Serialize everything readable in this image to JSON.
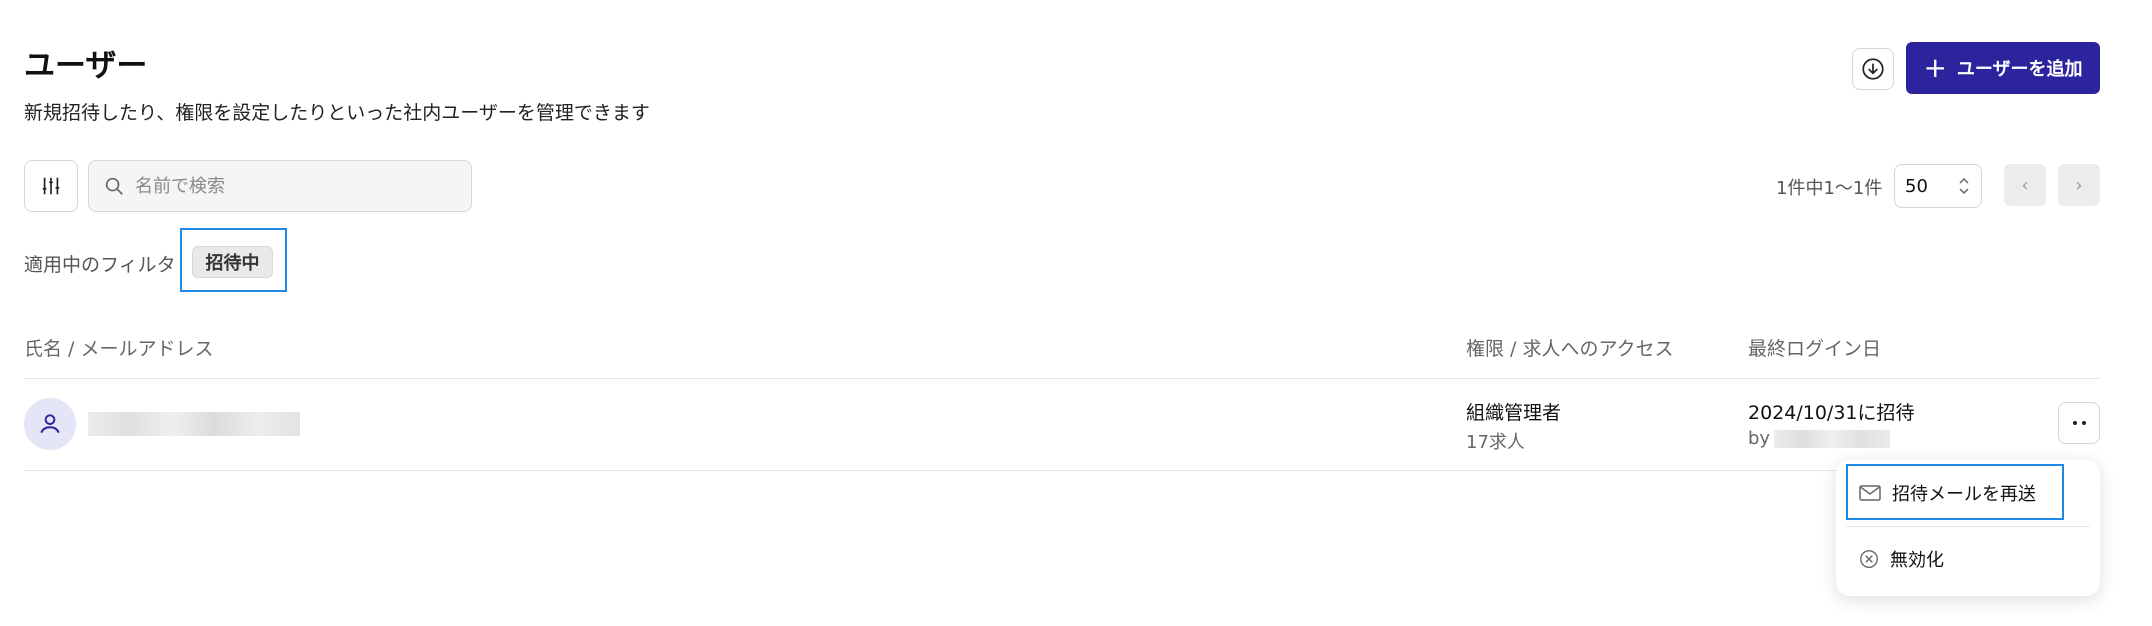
{
  "header": {
    "title": "ユーザー",
    "subtitle": "新規招待したり、権限を設定したりといった社内ユーザーを管理できます",
    "export_icon": "download-circle-icon",
    "add_button_label": "ユーザーを追加",
    "add_button_color": "#2b249c"
  },
  "toolbar": {
    "filter_icon": "sliders-icon",
    "search_placeholder": "名前で検索",
    "search_value": "",
    "page_count": "1件中1〜1件",
    "per_page": "50",
    "prev_icon": "chevron-left-icon",
    "next_icon": "chevron-right-icon"
  },
  "filters": {
    "label": "適用中のフィルタ",
    "chips": [
      "招待中"
    ]
  },
  "table": {
    "columns": [
      "氏名 / メールアドレス",
      "権限 / 求人へのアクセス",
      "最終ログイン日"
    ],
    "rows": [
      {
        "role": "組織管理者",
        "jobs": "17求人",
        "last_login": "2024/10/31に招待",
        "by_prefix": "by"
      }
    ]
  },
  "row_menu": {
    "items": [
      {
        "label": "招待メールを再送",
        "icon": "mail-icon"
      },
      {
        "label": "無効化",
        "icon": "circle-x-icon"
      }
    ]
  },
  "colors": {
    "accent": "#2b249c",
    "focus_outline": "#1e88e5",
    "avatar_bg": "#e4e5f7"
  }
}
